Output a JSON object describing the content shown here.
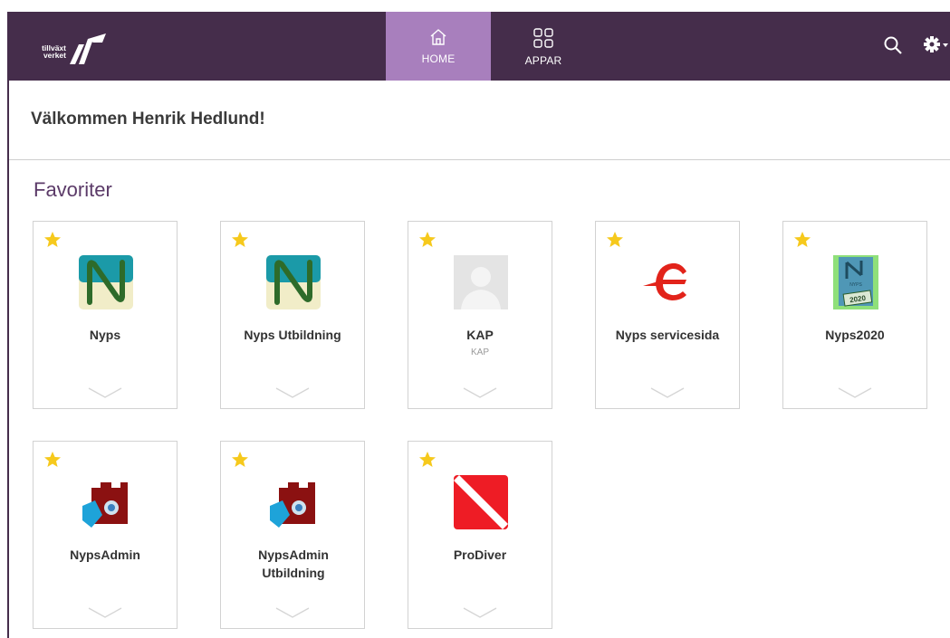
{
  "navbar": {
    "logo_text_line1": "tillväxt",
    "logo_text_line2": "verket",
    "tabs": [
      {
        "label": "HOME",
        "icon": "home-icon",
        "active": true
      },
      {
        "label": "APPAR",
        "icon": "apps-grid-icon",
        "active": false
      }
    ],
    "colors": {
      "bar": "#452d4b",
      "active_tab": "#a87fbd"
    }
  },
  "welcome": "Välkommen Henrik Hedlund!",
  "favorites": {
    "title": "Favoriter",
    "tiles": [
      {
        "name": "Nyps",
        "subtitle": "",
        "icon": "nyps-icon"
      },
      {
        "name": "Nyps Utbildning",
        "subtitle": "",
        "icon": "nyps-icon"
      },
      {
        "name": "KAP",
        "subtitle": "KAP",
        "icon": "placeholder-person-icon"
      },
      {
        "name": "Nyps servicesida",
        "subtitle": "",
        "icon": "red-e-icon"
      },
      {
        "name": "Nyps2020",
        "subtitle": "",
        "icon": "nyps2020-icon"
      },
      {
        "name": "NypsAdmin",
        "subtitle": "",
        "icon": "admin-gear-icon"
      },
      {
        "name": "NypsAdmin Utbildning",
        "subtitle": "",
        "icon": "admin-gear-icon"
      },
      {
        "name": "ProDiver",
        "subtitle": "",
        "icon": "prodiver-flag-icon"
      }
    ]
  },
  "nyps2020_badge": "2020",
  "nyps2020_label": "NYPS"
}
